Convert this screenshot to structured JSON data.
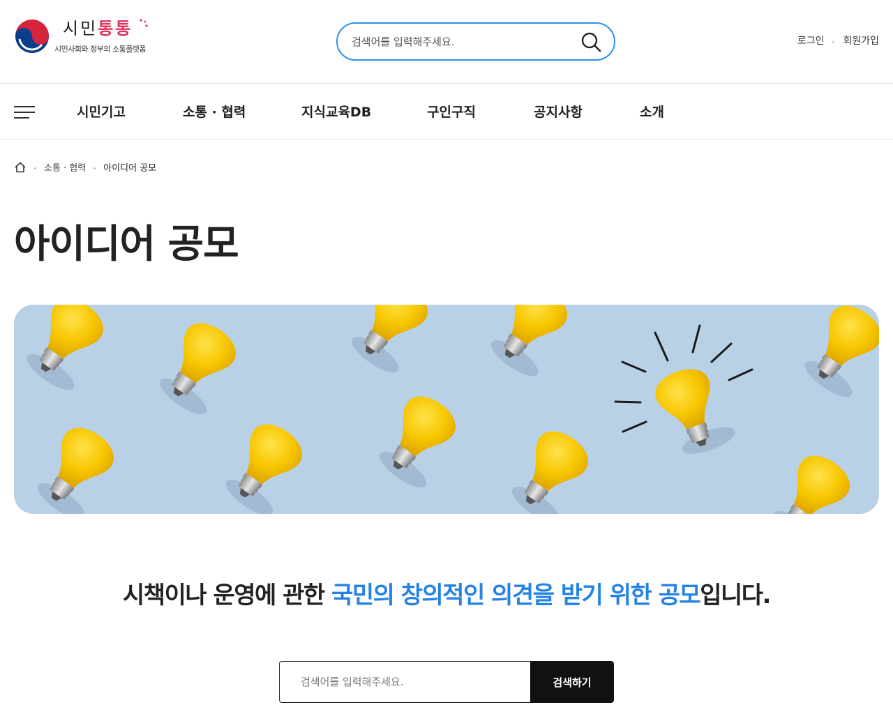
{
  "header": {
    "logo_title_part1": "시민",
    "logo_title_part2": "통통",
    "logo_subtitle": "시민사회와 정부의 소통플랫폼",
    "search_placeholder": "검색어를 입력해주세요.",
    "search_icon": "search-icon",
    "login_label": "로그인",
    "signup_label": "회원가입"
  },
  "gnb": {
    "menu_icon": "hamburger-menu-icon",
    "items": [
      {
        "label": "시민기고"
      },
      {
        "label": "소통 · 협력"
      },
      {
        "label": "지식교육DB"
      },
      {
        "label": "구인구직"
      },
      {
        "label": "공지사항"
      },
      {
        "label": "소개"
      }
    ]
  },
  "breadcrumb": {
    "home_icon": "home-icon",
    "items": [
      "소통 · 협력",
      "아이디어 공모"
    ]
  },
  "page": {
    "title": "아이디어 공모",
    "banner_image": "yellow light bulbs on light blue background, one glowing bulb",
    "lead_text_before": "시책이나 운영에 관한 ",
    "lead_text_highlight": "국민의 창의적인 의견을 받기 위한 공모",
    "lead_text_after": "입니다.",
    "search_placeholder": "검색어를 입력해주세요.",
    "search_button": "검색하기"
  },
  "colors": {
    "accent_blue": "#2f8ff0",
    "highlight_blue": "#2582e5",
    "logo_pink": "#e2335f",
    "banner_bg": "#b9d1e6",
    "bulb_yellow": "#f7c600",
    "button_black": "#111111"
  }
}
